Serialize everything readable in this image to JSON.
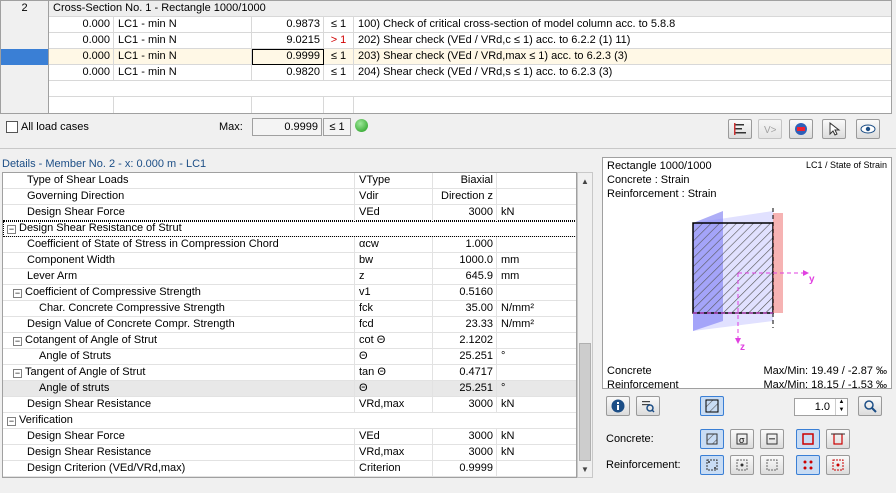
{
  "top_grid": {
    "header": {
      "row_no": "2",
      "title": "Cross-Section No. 1 - Rectangle 1000/1000"
    },
    "rows": [
      {
        "loc": "0.000",
        "lc": "LC1 - min N",
        "ratio": "0.9873",
        "cmp": "≤ 1",
        "desc": "100) Check of critical cross-section of model column acc. to 5.8.8"
      },
      {
        "loc": "0.000",
        "lc": "LC1 - min N",
        "ratio": "9.0215",
        "cmp": "> 1",
        "desc": "202) Shear check (VEd / VRd,c ≤ 1) acc. to 6.2.2 (1) 11)"
      },
      {
        "loc": "0.000",
        "lc": "LC1 - min N",
        "ratio": "0.9999",
        "cmp": "≤ 1",
        "desc": "203) Shear check (VEd / VRd,max ≤ 1) acc. to 6.2.3 (3)"
      },
      {
        "loc": "0.000",
        "lc": "LC1 - min N",
        "ratio": "0.9820",
        "cmp": "≤ 1",
        "desc": "204) Shear check (VEd / VRd,s ≤ 1) acc. to 6.2.3 (3)"
      }
    ]
  },
  "toolbar": {
    "all_load_cases": "All load cases",
    "max_label": "Max:",
    "max_value": "0.9999",
    "max_cmp": "≤ 1"
  },
  "details": {
    "header": "Details  -  Member No. 2  -  x: 0.000 m  -  LC1",
    "rows": [
      {
        "name": "Type of Shear Loads",
        "sym": "VType",
        "val": "Biaxial",
        "unit": ""
      },
      {
        "name": "Governing Direction",
        "sym": "Vdir",
        "val": "Direction z",
        "unit": ""
      },
      {
        "name": "Design Shear Force",
        "sym": "VEd",
        "val": "3000",
        "unit": "kN"
      },
      {
        "name": "Design Shear Resistance of Strut",
        "sym": "",
        "val": "",
        "unit": ""
      },
      {
        "name": "Coefficient of State of Stress in Compression Chord",
        "sym": "αcw",
        "val": "1.000",
        "unit": ""
      },
      {
        "name": "Component Width",
        "sym": "bw",
        "val": "1000.0",
        "unit": "mm"
      },
      {
        "name": "Lever Arm",
        "sym": "z",
        "val": "645.9",
        "unit": "mm"
      },
      {
        "name": "Coefficient of Compressive Strength",
        "sym": "v1",
        "val": "0.5160",
        "unit": ""
      },
      {
        "name": "Char. Concrete Compressive Strength",
        "sym": "fck",
        "val": "35.00",
        "unit": "N/mm²"
      },
      {
        "name": "Design Value of Concrete Compr. Strength",
        "sym": "fcd",
        "val": "23.33",
        "unit": "N/mm²"
      },
      {
        "name": "Cotangent of Angle of Strut",
        "sym": "cot Θ",
        "val": "2.1202",
        "unit": ""
      },
      {
        "name": "Angle of Struts",
        "sym": "Θ",
        "val": "25.251",
        "unit": "°"
      },
      {
        "name": "Tangent of Angle of Strut",
        "sym": "tan Θ",
        "val": "0.4717",
        "unit": ""
      },
      {
        "name": "Angle of struts",
        "sym": "Θ",
        "val": "25.251",
        "unit": "°"
      },
      {
        "name": "Design Shear Resistance",
        "sym": "VRd,max",
        "val": "3000",
        "unit": "kN"
      },
      {
        "name": "Verification",
        "sym": "",
        "val": "",
        "unit": ""
      },
      {
        "name": "Design Shear Force",
        "sym": "VEd",
        "val": "3000",
        "unit": "kN"
      },
      {
        "name": "Design Shear Resistance",
        "sym": "VRd,max",
        "val": "3000",
        "unit": "kN"
      },
      {
        "name": "Design Criterion (VEd/VRd,max)",
        "sym": "Criterion",
        "val": "0.9999",
        "unit": ""
      }
    ]
  },
  "right_panel": {
    "title_left": "Rectangle 1000/1000",
    "line2": "Concrete : Strain",
    "line3": "Reinforcement : Strain",
    "title_right": "LC1 / State of Strain",
    "axis_y": "y",
    "axis_z": "z",
    "concrete_label": "Concrete",
    "concrete_maxmin": "Max/Min: 19.49 / -2.87 ‰",
    "reinf_label": "Reinforcement",
    "reinf_maxmin": "Max/Min: 18.15 / -1.53 ‰",
    "scale_value": "1.0",
    "concrete_row_label": "Concrete:",
    "reinf_row_label": "Reinforcement:"
  }
}
